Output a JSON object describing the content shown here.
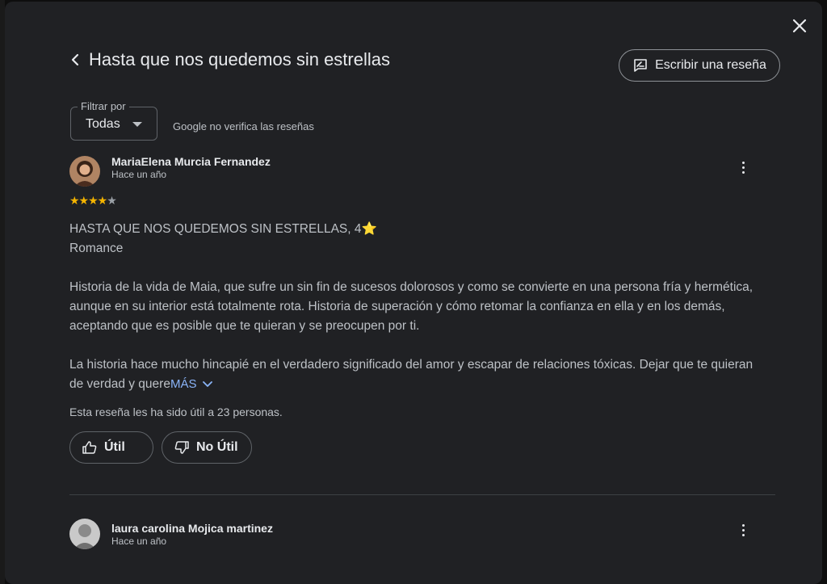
{
  "dialog": {
    "title": "Hasta que nos quedemos sin estrellas",
    "write_review_label": "Escribir una reseña"
  },
  "filter": {
    "legend": "Filtrar por",
    "value": "Todas",
    "note": "Google no verifica las reseñas"
  },
  "reviews": [
    {
      "author": "MariaElena Murcia Fernandez",
      "time": "Hace un año",
      "rating": 4,
      "stars_filled": "★★★★",
      "stars_empty": "★",
      "headline": "HASTA QUE NOS QUEDEMOS SIN ESTRELLAS, 4⭐",
      "genre": "Romance",
      "paragraph1": "Historia de la vida de Maia, que sufre un sin fin de sucesos dolorosos y como se convierte en una persona fría y hermética, aunque en su interior está totalmente rota. Historia de superación y cómo retomar la confianza en ella y en los demás, aceptando que es posible que te quieran y se preocupen por ti.",
      "paragraph2": "La historia hace mucho hincapié en el verdadero significado del amor y escapar de relaciones tóxicas. Dejar que te quieran de verdad y quere",
      "more_label": "MÁS",
      "helpful_note": "Esta reseña les ha sido útil a 23 personas.",
      "useful_label": "Útil",
      "not_useful_label": "No Útil"
    },
    {
      "author": "laura carolina Mojica martinez",
      "time": "Hace un año"
    }
  ],
  "icons": {
    "close": "close-icon",
    "back": "chevron-left-icon",
    "write": "rate-review-icon",
    "more": "more-vert-icon",
    "thumb_up": "thumb-up-icon",
    "thumb_down": "thumb-down-icon"
  },
  "colors": {
    "dialog_bg": "#202124",
    "star": "#f4b400",
    "link": "#8ab4f8"
  }
}
